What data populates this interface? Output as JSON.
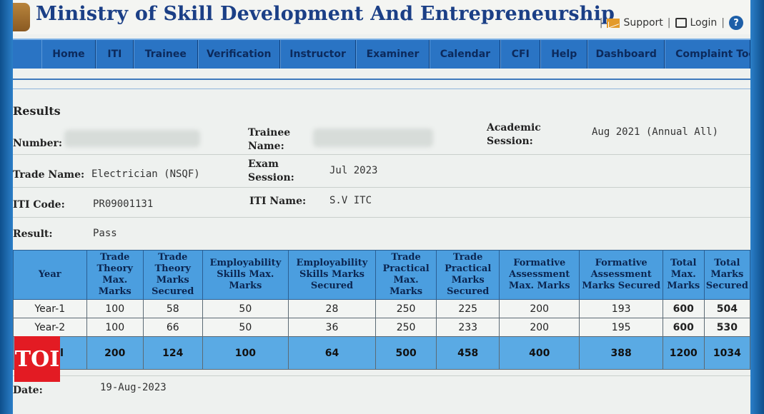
{
  "header": {
    "title": "Ministry of Skill Development And Entrepreneurship",
    "support": "Support",
    "login": "Login",
    "help_glyph": "?"
  },
  "nav": [
    "Home",
    "ITI",
    "Trainee",
    "Verification",
    "Instructor",
    "Examiner",
    "Calendar",
    "CFI",
    "Help",
    "Dashboard",
    "Complaint Too"
  ],
  "section_title": "Results",
  "info": {
    "roll_label": "Number:",
    "trainee_name_label": "Trainee Name:",
    "academic_session_label": "Academic Session:",
    "academic_session": "Aug 2021 (Annual All)",
    "trade_label": "Trade Name:",
    "trade": "Electrician (NSQF)",
    "exam_session_label": "Exam Session:",
    "exam_session": "Jul 2023",
    "code_label": "ITI Code:",
    "code": "PR09001131",
    "iti_name_label": "ITI Name:",
    "iti_name": "S.V ITC",
    "result_label": "Result:",
    "result": "Pass",
    "date_label": "Date:",
    "date": "19-Aug-2023"
  },
  "table": {
    "headers": [
      "Year",
      "Trade Theory Max. Marks",
      "Trade Theory Marks Secured",
      "Employability Skills Max. Marks",
      "Employability Skills Marks Secured",
      "Trade Practical Max. Marks",
      "Trade Practical Marks Secured",
      "Formative Assessment Max. Marks",
      "Formative Assessment Marks Secured",
      "Total Max. Marks",
      "Total Marks Secured"
    ],
    "rows": [
      [
        "Year-1",
        "100",
        "58",
        "50",
        "28",
        "250",
        "225",
        "200",
        "193",
        "600",
        "504"
      ],
      [
        "Year-2",
        "100",
        "66",
        "50",
        "36",
        "250",
        "233",
        "200",
        "195",
        "600",
        "530"
      ]
    ],
    "total": [
      "Total",
      "200",
      "124",
      "100",
      "64",
      "500",
      "458",
      "400",
      "388",
      "1200",
      "1034"
    ]
  },
  "watermark": "TOI",
  "colors": {
    "nav": "#2a74c4",
    "title": "#1b3f86",
    "table_header": "#4b9edf",
    "watermark": "#e31b23"
  }
}
